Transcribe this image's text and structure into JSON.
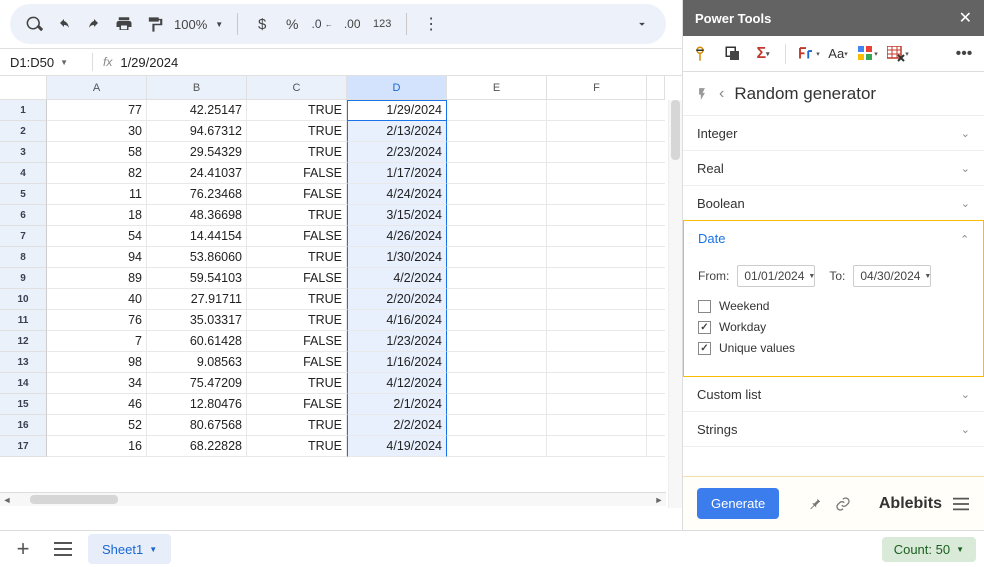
{
  "toolbar": {
    "zoom": "100%",
    "fmt123": "123"
  },
  "namebox": {
    "range": "D1:D50",
    "formula": "1/29/2024"
  },
  "columns": [
    "A",
    "B",
    "C",
    "D",
    "E",
    "F"
  ],
  "rows": [
    {
      "n": 1,
      "a": "77",
      "b": "42.25147",
      "c": "TRUE",
      "d": "1/29/2024"
    },
    {
      "n": 2,
      "a": "30",
      "b": "94.67312",
      "c": "TRUE",
      "d": "2/13/2024"
    },
    {
      "n": 3,
      "a": "58",
      "b": "29.54329",
      "c": "TRUE",
      "d": "2/23/2024"
    },
    {
      "n": 4,
      "a": "82",
      "b": "24.41037",
      "c": "FALSE",
      "d": "1/17/2024"
    },
    {
      "n": 5,
      "a": "11",
      "b": "76.23468",
      "c": "FALSE",
      "d": "4/24/2024"
    },
    {
      "n": 6,
      "a": "18",
      "b": "48.36698",
      "c": "TRUE",
      "d": "3/15/2024"
    },
    {
      "n": 7,
      "a": "54",
      "b": "14.44154",
      "c": "FALSE",
      "d": "4/26/2024"
    },
    {
      "n": 8,
      "a": "94",
      "b": "53.86060",
      "c": "TRUE",
      "d": "1/30/2024"
    },
    {
      "n": 9,
      "a": "89",
      "b": "59.54103",
      "c": "FALSE",
      "d": "4/2/2024"
    },
    {
      "n": 10,
      "a": "40",
      "b": "27.91711",
      "c": "TRUE",
      "d": "2/20/2024"
    },
    {
      "n": 11,
      "a": "76",
      "b": "35.03317",
      "c": "TRUE",
      "d": "4/16/2024"
    },
    {
      "n": 12,
      "a": "7",
      "b": "60.61428",
      "c": "FALSE",
      "d": "1/23/2024"
    },
    {
      "n": 13,
      "a": "98",
      "b": "9.08563",
      "c": "FALSE",
      "d": "1/16/2024"
    },
    {
      "n": 14,
      "a": "34",
      "b": "75.47209",
      "c": "TRUE",
      "d": "4/12/2024"
    },
    {
      "n": 15,
      "a": "46",
      "b": "12.80476",
      "c": "FALSE",
      "d": "2/1/2024"
    },
    {
      "n": 16,
      "a": "52",
      "b": "80.67568",
      "c": "TRUE",
      "d": "2/2/2024"
    },
    {
      "n": 17,
      "a": "16",
      "b": "68.22828",
      "c": "TRUE",
      "d": "4/19/2024"
    }
  ],
  "sheet_tab": "Sheet1",
  "count_chip": "Count: 50",
  "panel": {
    "title": "Power Tools",
    "crumb": "Random generator",
    "sections": {
      "integer": "Integer",
      "real": "Real",
      "boolean": "Boolean",
      "date": "Date",
      "custom": "Custom list",
      "strings": "Strings"
    },
    "date": {
      "from_lbl": "From:",
      "from_val": "01/01/2024",
      "to_lbl": "To:",
      "to_val": "04/30/2024",
      "weekend": "Weekend",
      "workday": "Workday",
      "unique": "Unique values"
    },
    "generate": "Generate",
    "brand": "Ablebits"
  }
}
